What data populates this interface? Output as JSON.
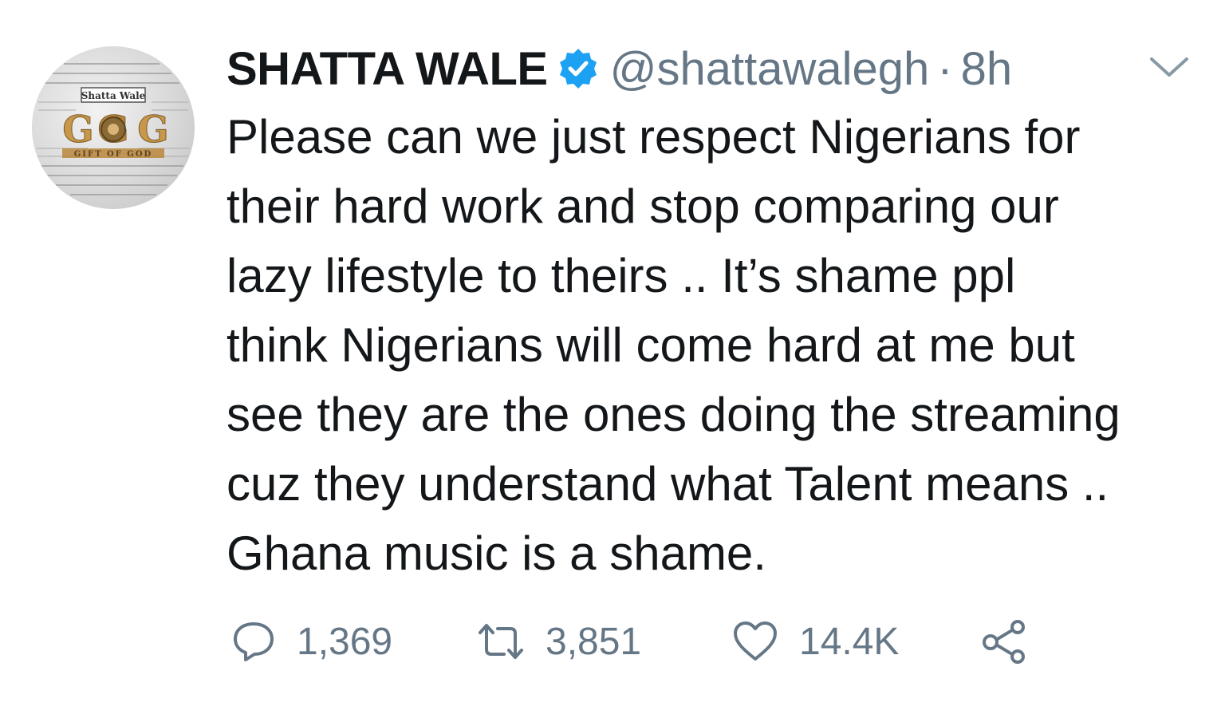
{
  "tweet": {
    "display_name": "SHATTA WALE",
    "handle": "@shattawalegh",
    "separator": "·",
    "time": "8h",
    "text_lines": [
      "Please can we just respect Nigerians for",
      "their hard work and stop comparing our",
      "lazy lifestyle to theirs .. It’s shame ppl",
      "think Nigerians will come hard at me but",
      "see they are the ones doing the streaming",
      "cuz they understand what Talent means ..",
      "Ghana music is a shame."
    ],
    "avatar": {
      "top_label": "Shatta Wale",
      "logo_text": "GOG",
      "sub_text": "GIFT OF GOD"
    }
  },
  "actions": {
    "reply_count": "1,369",
    "retweet_count": "3,851",
    "like_count": "14.4K"
  },
  "colors": {
    "text": "#14171a",
    "muted": "#657786",
    "verified": "#1da1f2",
    "avatar_gold": "#b8863b"
  },
  "icons": {
    "verified": "verified-badge-icon",
    "caret": "chevron-down-icon",
    "reply": "reply-icon",
    "retweet": "retweet-icon",
    "like": "heart-icon",
    "share": "share-icon"
  }
}
